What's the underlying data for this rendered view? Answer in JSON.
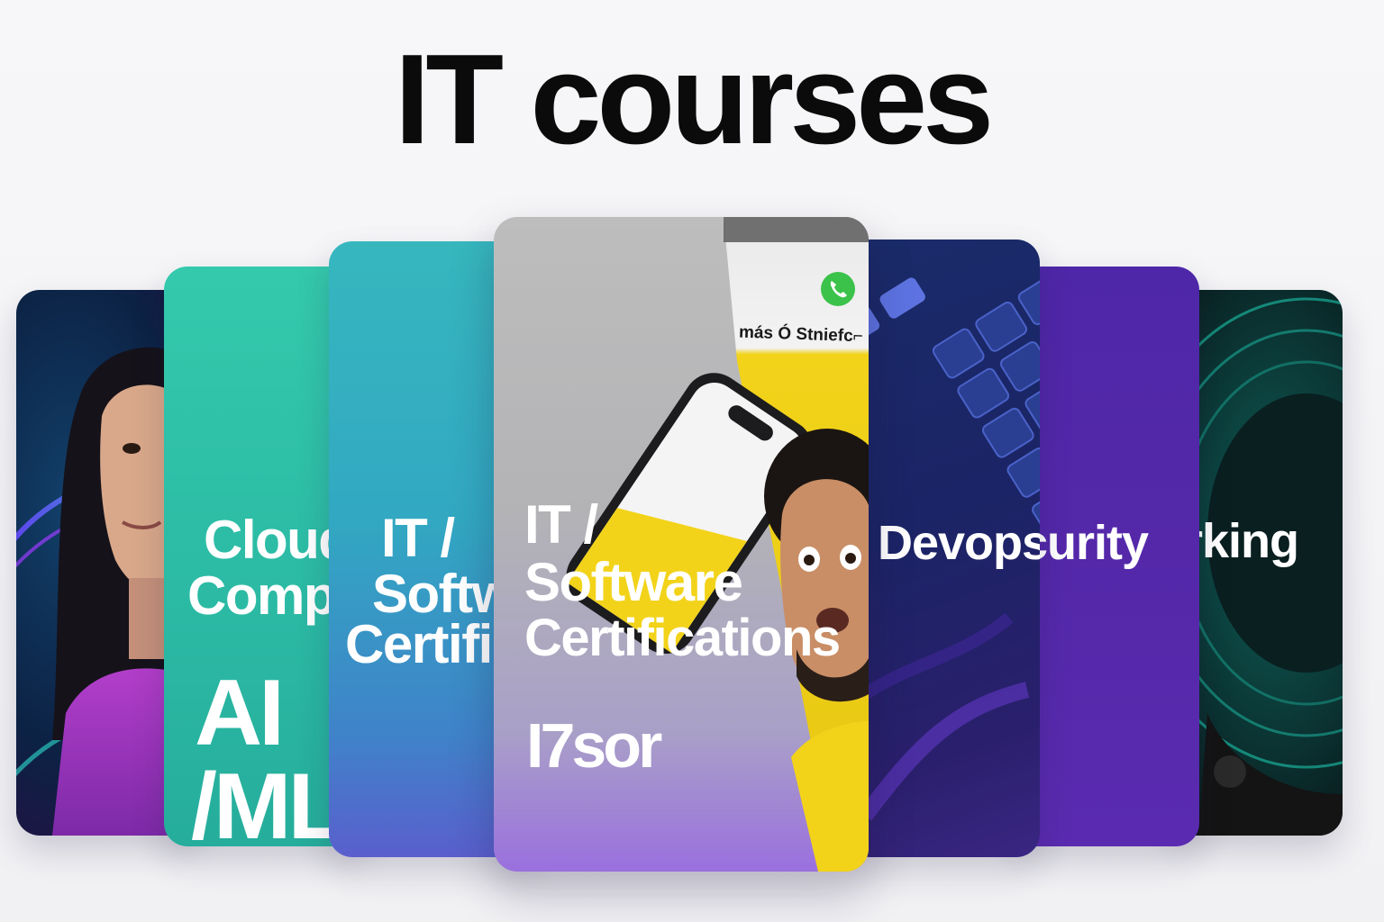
{
  "page": {
    "title": "IT courses"
  },
  "cards": [
    {
      "id": "portrait"
    },
    {
      "id": "ai-ml",
      "title_line1": "Cloud",
      "title_line2": "Comp",
      "label_line1": "AI",
      "label_line2": "/ML"
    },
    {
      "id": "it-software-back",
      "title_line1": "IT /",
      "title_line2": "Softw",
      "title_line3": "Certific"
    },
    {
      "id": "it-software-center",
      "title_line1": "IT /",
      "title_line2": "Software",
      "title_line3": "Certifications",
      "footer": "I7sor",
      "phone_caption": "más Ó Stniefc⌐"
    },
    {
      "id": "devops",
      "title": "Devops"
    },
    {
      "id": "security",
      "title": "curity"
    },
    {
      "id": "networking",
      "title": "rking"
    }
  ],
  "colors": {
    "title": "#0b0b0b",
    "teal": "#2bb9a4",
    "purple": "#5428a9",
    "center_gray": "#b3b3b6",
    "accent_yellow": "#f2d31a",
    "call_green": "#3bc24a"
  },
  "icons": [
    "phone-call-icon"
  ]
}
